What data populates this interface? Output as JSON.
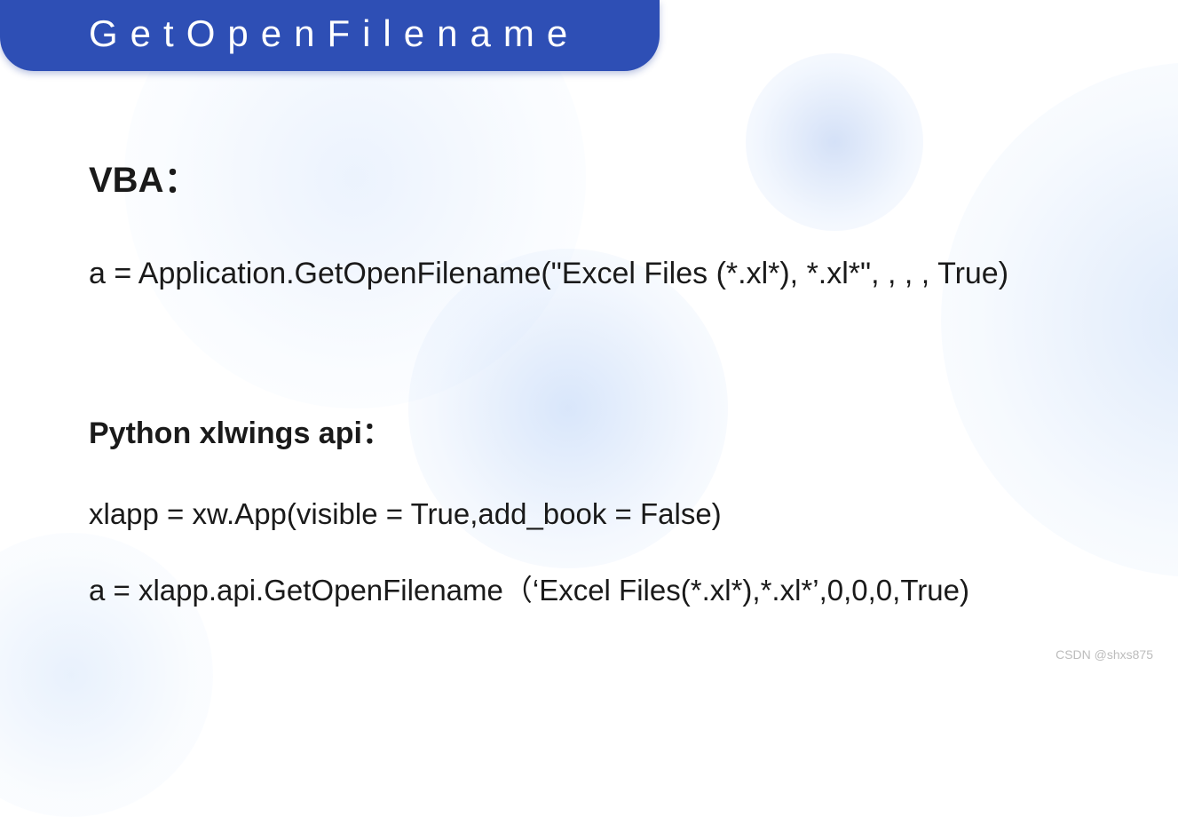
{
  "title": "GetOpenFilename",
  "sections": {
    "vba": {
      "heading": "VBA：",
      "code": "a = Application.GetOpenFilename(\"Excel Files (*.xl*), *.xl*\", , , , True)"
    },
    "python": {
      "heading": "Python xlwings api：",
      "code1": "xlapp = xw.App(visible = True,add_book = False)",
      "code2": "a = xlapp.api.GetOpenFilename（‘Excel Files(*.xl*),*.xl*’,0,0,0,True)"
    }
  },
  "watermark": "CSDN @shxs875"
}
